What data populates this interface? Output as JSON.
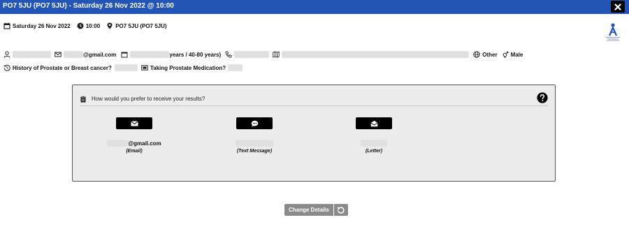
{
  "window": {
    "title": "PO7 5JU (PO7 5JU) - Saturday 26 Nov 2022 @ 10:00",
    "close_icon": "close-icon"
  },
  "appointment": {
    "date": "Saturday 26 Nov 2022",
    "time": "10:00",
    "location": "PO7 5JU (PO7 5JU)"
  },
  "patient": {
    "email_suffix": "@gmail.com",
    "age_text": "years / 40-80 years)",
    "ethnicity": "Other",
    "gender": "Male",
    "history_label": "History of Prostate or Breast cancer?",
    "medication_label": "Taking Prostate Medication?"
  },
  "results": {
    "question": "How would you prefer to receive your results?",
    "options": [
      {
        "value": "@gmail.com",
        "label": "(Email)",
        "icon": "envelope-icon"
      },
      {
        "value": "",
        "label": "(Text Message)",
        "icon": "chat-bubble-icon"
      },
      {
        "value": "",
        "label": "(Letter)",
        "icon": "open-envelope-icon"
      }
    ]
  },
  "footer": {
    "change_details_label": "Change Details",
    "undo_icon": "undo-icon"
  },
  "colors": {
    "titlebar": "#2255b5",
    "panel_bg": "#ececec",
    "button_dark": "#000000",
    "button_grey": "#8a8a8a"
  }
}
